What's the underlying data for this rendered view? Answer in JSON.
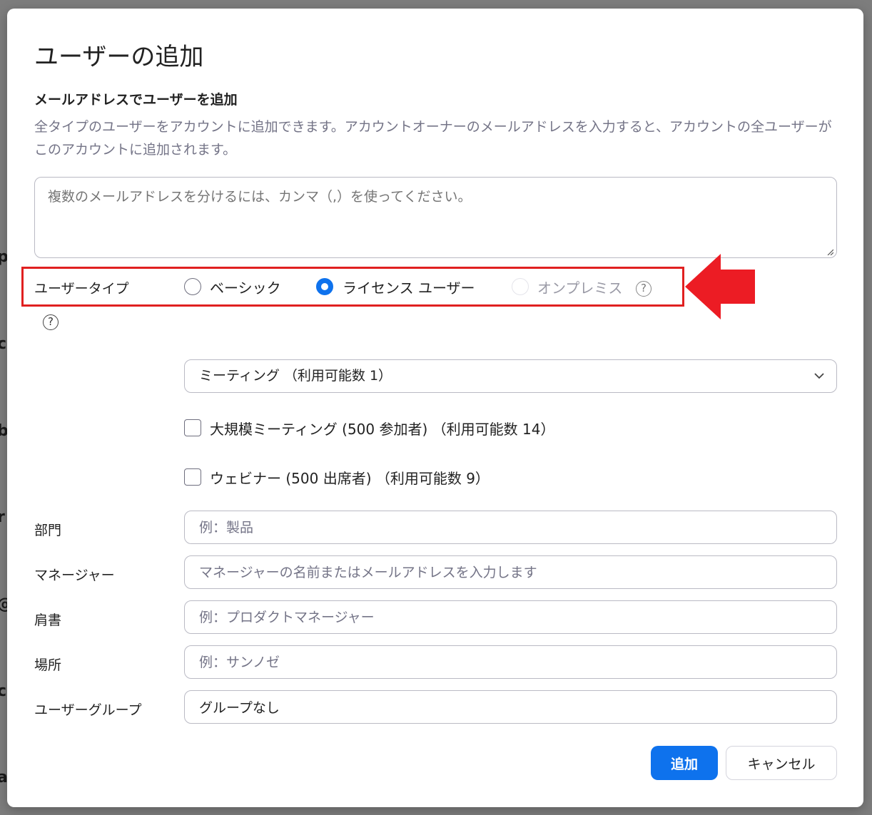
{
  "background": {
    "fragments": [
      "p",
      "c",
      "b",
      "r",
      "@",
      "c",
      "a"
    ]
  },
  "dialog": {
    "title": "ユーザーの追加",
    "subtitle": "メールアドレスでユーザーを追加",
    "description": "全タイプのユーザーをアカウントに追加できます。アカウントオーナーのメールアドレスを入力すると、アカウントの全ユーザーがこのアカウントに追加されます。",
    "email_placeholder": "複数のメールアドレスを分けるには、カンマ（,）を使ってください。",
    "email_value": "",
    "user_type": {
      "label": "ユーザータイプ",
      "options": [
        {
          "label": "ベーシック",
          "selected": false,
          "disabled": false
        },
        {
          "label": "ライセンス ユーザー",
          "selected": true,
          "disabled": false
        },
        {
          "label": "オンプレミス",
          "selected": false,
          "disabled": true
        }
      ]
    },
    "license_select": {
      "value": "ミーティング （利用可能数 1）"
    },
    "addons": [
      {
        "label": "大規模ミーティング (500 参加者) （利用可能数 14）",
        "checked": false
      },
      {
        "label": "ウェビナー (500 出席者) （利用可能数 9）",
        "checked": false
      }
    ],
    "fields": {
      "department": {
        "label": "部門",
        "placeholder": "例：製品"
      },
      "manager": {
        "label": "マネージャー",
        "placeholder": "マネージャーの名前またはメールアドレスを入力します"
      },
      "job_title": {
        "label": "肩書",
        "placeholder": "例：プロダクトマネージャー"
      },
      "location": {
        "label": "場所",
        "placeholder": "例：サンノゼ"
      },
      "user_group": {
        "label": "ユーザーグループ",
        "value": "グループなし"
      }
    },
    "buttons": {
      "add": "追加",
      "cancel": "キャンセル"
    }
  },
  "colors": {
    "primary": "#0e72ed",
    "highlight": "#e02020",
    "muted_text": "#747487"
  }
}
